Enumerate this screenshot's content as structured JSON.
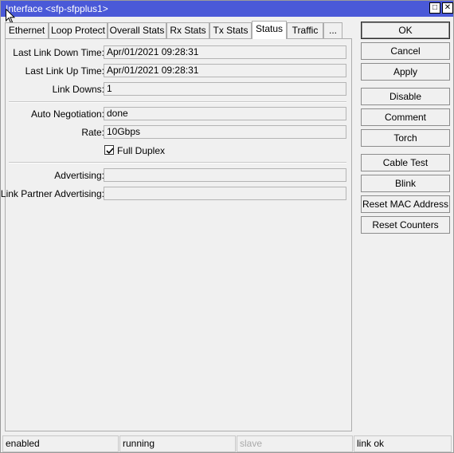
{
  "window": {
    "title": "Interface <sfp-sfpplus1>",
    "maximize_glyph": "□",
    "close_glyph": "✕"
  },
  "tabs": [
    {
      "label": "Ethernet"
    },
    {
      "label": "Loop Protect"
    },
    {
      "label": "Overall Stats"
    },
    {
      "label": "Rx Stats"
    },
    {
      "label": "Tx Stats"
    },
    {
      "label": "Status",
      "active": true
    },
    {
      "label": "Traffic"
    },
    {
      "label": "..."
    }
  ],
  "status": {
    "last_link_down_time": {
      "label": "Last Link Down Time:",
      "value": "Apr/01/2021 09:28:31"
    },
    "last_link_up_time": {
      "label": "Last Link Up Time:",
      "value": "Apr/01/2021 09:28:31"
    },
    "link_downs": {
      "label": "Link Downs:",
      "value": "1"
    },
    "auto_negotiation": {
      "label": "Auto Negotiation:",
      "value": "done"
    },
    "rate": {
      "label": "Rate:",
      "value": "10Gbps"
    },
    "full_duplex": {
      "label": "Full Duplex",
      "checked": true
    },
    "advertising": {
      "label": "Advertising:",
      "value": ""
    },
    "link_partner_advertising": {
      "label": "Link Partner Advertising:",
      "value": ""
    }
  },
  "buttons": {
    "ok": "OK",
    "cancel": "Cancel",
    "apply": "Apply",
    "disable": "Disable",
    "comment": "Comment",
    "torch": "Torch",
    "cable_test": "Cable Test",
    "blink": "Blink",
    "reset_mac": "Reset MAC Address",
    "reset_counters": "Reset Counters"
  },
  "statusbar": {
    "state": "enabled",
    "running": "running",
    "slave": "slave",
    "link": "link ok"
  },
  "colors": {
    "titlebar": "#4a59d8",
    "window_bg": "#f0f0f0"
  }
}
